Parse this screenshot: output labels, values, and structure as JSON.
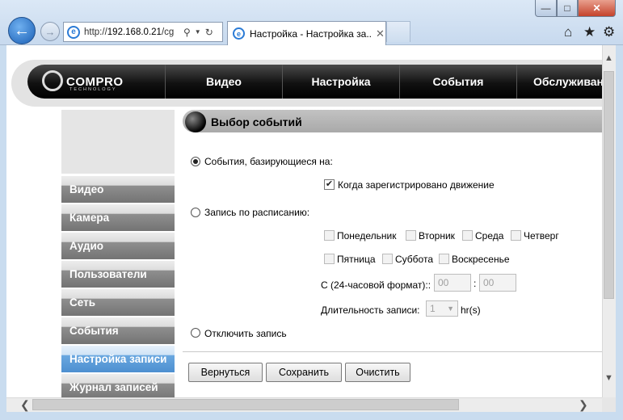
{
  "browser": {
    "back_icon": "arrow-left-icon",
    "forward_icon": "arrow-right-icon",
    "address_prefix": "http://",
    "address_host": "192.168.0.21",
    "address_rest": "/cg",
    "tab_title": "Настройка - Настройка за...",
    "window_buttons": {
      "minimize": "—",
      "maximize": "□",
      "close": "✕"
    },
    "toolbar_icons": [
      "home-icon",
      "favorites-star-icon",
      "settings-gear-icon"
    ]
  },
  "site": {
    "logo_text": "COMPRO",
    "logo_sub": "TECHNOLOGY",
    "nav": [
      "Видео",
      "Настройка",
      "События",
      "Обслуживан"
    ]
  },
  "sidebar": {
    "items": [
      {
        "label": "Видео",
        "active": false
      },
      {
        "label": "Камера",
        "active": false
      },
      {
        "label": "Аудио",
        "active": false
      },
      {
        "label": "Пользователи",
        "active": false
      },
      {
        "label": "Сеть",
        "active": false
      },
      {
        "label": "События",
        "active": false
      },
      {
        "label": "Настройка записи",
        "active": true
      },
      {
        "label": "Журнал записей",
        "active": false
      }
    ]
  },
  "content": {
    "title": "Выбор событий",
    "option_events": "События, базирующиеся на:",
    "motion_label": "Когда зарегистрировано движение",
    "option_schedule": "Запись по расписанию:",
    "days": [
      "Понедельник",
      "Вторник",
      "Среда",
      "Четверг",
      "Пятница",
      "Суббота",
      "Воскресенье"
    ],
    "time_label": "С (24-часовой формат)::",
    "time_sep": ":",
    "hour_value": "00",
    "minute_value": "00",
    "duration_label": "Длительность записи:",
    "duration_value": "1",
    "duration_unit": "hr(s)",
    "option_disable": "Отключить запись",
    "selected_option": "events",
    "motion_checked": true
  },
  "buttons": {
    "back": "Вернуться",
    "save": "Сохранить",
    "clear": "Очистить"
  }
}
